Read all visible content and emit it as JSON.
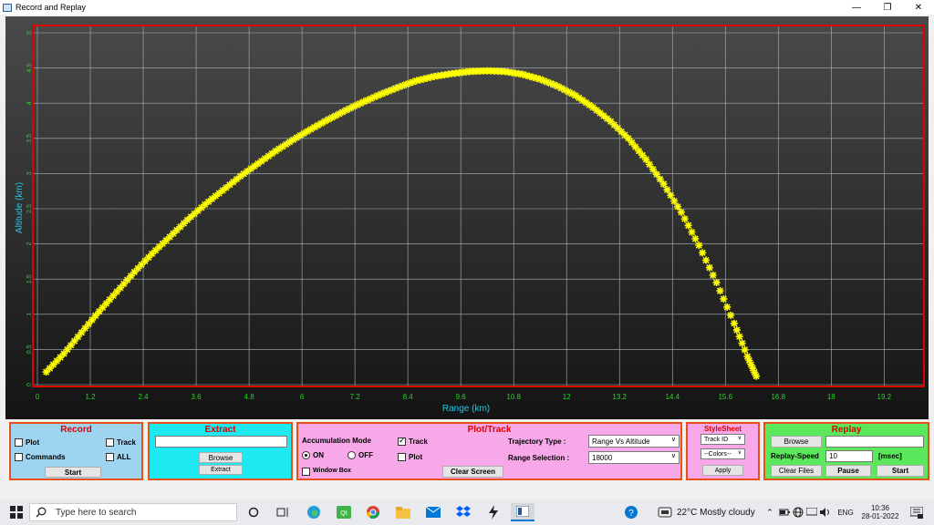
{
  "window": {
    "title": "Record and Replay"
  },
  "chart_data": {
    "type": "scatter",
    "xlabel": "Range (km)",
    "ylabel": "Altitude (km)",
    "xlim": [
      0,
      20
    ],
    "ylim": [
      0,
      5
    ],
    "xticks": [
      "0",
      "1.2",
      "2.4",
      "3.6",
      "4.8",
      "6",
      "7.2",
      "8.4",
      "9.6",
      "10.8",
      "12",
      "13.2",
      "14.4",
      "15.6",
      "16.8",
      "18",
      "19.2"
    ],
    "yticks": [
      "0",
      "0.5",
      "1",
      "1.5",
      "2",
      "2.5",
      "3",
      "3.5",
      "4",
      "4.5",
      "5"
    ],
    "grid": true,
    "marker_color": "#ffff00",
    "series": [
      {
        "x": [
          0.2,
          0.6,
          1.0,
          1.4,
          1.8,
          2.2,
          2.6,
          3.0,
          3.4,
          3.8,
          4.2,
          4.6,
          5.0,
          5.4,
          5.8,
          6.2,
          6.6,
          7.0,
          7.4,
          7.8,
          8.2,
          8.6,
          9.0,
          9.4,
          9.8,
          10.2,
          10.6,
          11.0,
          11.4,
          11.8,
          12.2,
          12.6,
          13.0,
          13.4,
          13.8,
          14.2,
          14.6,
          15.0,
          15.4,
          15.8,
          16.1,
          16.3
        ],
        "y": [
          0.18,
          0.44,
          0.74,
          1.04,
          1.32,
          1.6,
          1.86,
          2.1,
          2.34,
          2.56,
          2.76,
          2.96,
          3.14,
          3.32,
          3.48,
          3.63,
          3.77,
          3.9,
          4.02,
          4.13,
          4.23,
          4.32,
          4.38,
          4.42,
          4.45,
          4.46,
          4.45,
          4.41,
          4.34,
          4.24,
          4.11,
          3.94,
          3.74,
          3.5,
          3.2,
          2.85,
          2.45,
          1.98,
          1.45,
          0.87,
          0.4,
          0.12
        ]
      }
    ]
  },
  "record": {
    "title": "Record",
    "plot": "Plot",
    "track": "Track",
    "commands": "Commands",
    "all": "ALL",
    "start": "Start"
  },
  "extract": {
    "title": "Extract",
    "input_value": "",
    "browse": "Browse",
    "extract": "Extract"
  },
  "plottrack": {
    "title": "Plot/Track",
    "accumulation_mode": "Accumulation Mode",
    "on": "ON",
    "off": "OFF",
    "track": "Track",
    "plot": "Plot",
    "window_box": "Window Box",
    "trajectory_type_label": "Trajectory Type :",
    "trajectory_type_value": "Range Vs Altitude",
    "range_selection_label": "Range Selection :",
    "range_selection_value": "18000",
    "clear_screen": "Clear Screen"
  },
  "stylesheet": {
    "title": "StyleSheet",
    "track_id": "Track ID",
    "colors": "--Colors--",
    "apply": "Apply"
  },
  "replay": {
    "title": "Replay",
    "browse": "Browse",
    "file_value": "",
    "speed_label": "Replay-Speed",
    "speed_value": "10",
    "unit": "[msec]",
    "clear_files": "Clear Files",
    "pause": "Pause",
    "start": "Start"
  },
  "taskbar": {
    "search_placeholder": "Type here to search",
    "weather": "22°C  Mostly cloudy",
    "lang": "ENG",
    "time": "10:36",
    "date": "28-01-2022"
  }
}
